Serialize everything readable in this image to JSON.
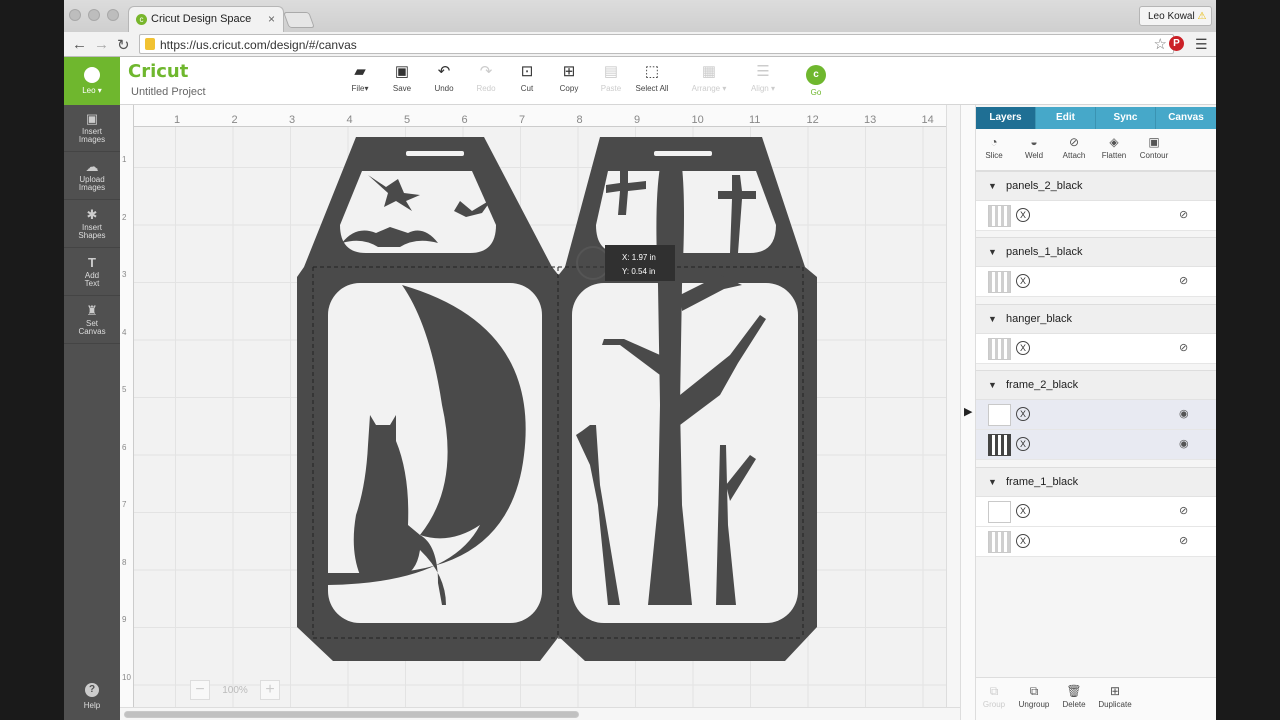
{
  "browser": {
    "tab_title": "Cricut Design Space",
    "url": "https://us.cricut.com/design/#/canvas",
    "user_chip": "Leo Kowal"
  },
  "rail": {
    "user": "Leo",
    "items": [
      {
        "label_1": "Insert",
        "label_2": "Images",
        "icon": "image-icon"
      },
      {
        "label_1": "Upload",
        "label_2": "Images",
        "icon": "upload-icon"
      },
      {
        "label_1": "Insert",
        "label_2": "Shapes",
        "icon": "shapes-icon"
      },
      {
        "label_1": "Add",
        "label_2": "Text",
        "icon": "text-icon"
      },
      {
        "label_1": "Set",
        "label_2": "Canvas",
        "icon": "shirt-icon"
      }
    ],
    "help": "Help"
  },
  "toolbar": {
    "logo": "Cricut",
    "project_name": "Untitled Project",
    "file": "File",
    "save": "Save",
    "undo": "Undo",
    "redo": "Redo",
    "cut": "Cut",
    "copy": "Copy",
    "paste": "Paste",
    "select_all": "Select All",
    "arrange": "Arrange",
    "align": "Align",
    "go": "Go"
  },
  "canvas": {
    "ruler_top": [
      "1",
      "2",
      "3",
      "4",
      "5",
      "6",
      "7",
      "8",
      "9",
      "10",
      "11",
      "12",
      "13",
      "14"
    ],
    "ruler_left": [
      "1",
      "2",
      "3",
      "4",
      "5",
      "6",
      "7",
      "8",
      "9",
      "10"
    ],
    "coord_x": "X: 1.97 in",
    "coord_y": "Y: 0.54 in",
    "zoom": "100%"
  },
  "panel": {
    "tabs": [
      "Layers",
      "Edit",
      "Sync",
      "Canvas"
    ],
    "tools": [
      "Slice",
      "Weld",
      "Attach",
      "Flatten",
      "Contour"
    ],
    "groups": [
      {
        "name": "panels_2_black",
        "rows": [
          {
            "visible": false,
            "thumb": "gray"
          }
        ]
      },
      {
        "name": "panels_1_black",
        "rows": [
          {
            "visible": false,
            "thumb": "gray"
          }
        ]
      },
      {
        "name": "hanger_black",
        "rows": [
          {
            "visible": false,
            "thumb": "gray"
          }
        ]
      },
      {
        "name": "frame_2_black",
        "rows": [
          {
            "visible": true,
            "thumb": "white"
          },
          {
            "visible": true,
            "thumb": "dark"
          }
        ]
      },
      {
        "name": "frame_1_black",
        "rows": [
          {
            "visible": false,
            "thumb": "white"
          },
          {
            "visible": false,
            "thumb": "gray"
          }
        ]
      }
    ],
    "footer": [
      "Group",
      "Ungroup",
      "Delete",
      "Duplicate"
    ]
  },
  "colors": {
    "accent_green": "#6fb72e",
    "tab_blue": "#46a8c9",
    "tab_active": "#1f6f94",
    "art_fill": "#4a4a4a"
  }
}
